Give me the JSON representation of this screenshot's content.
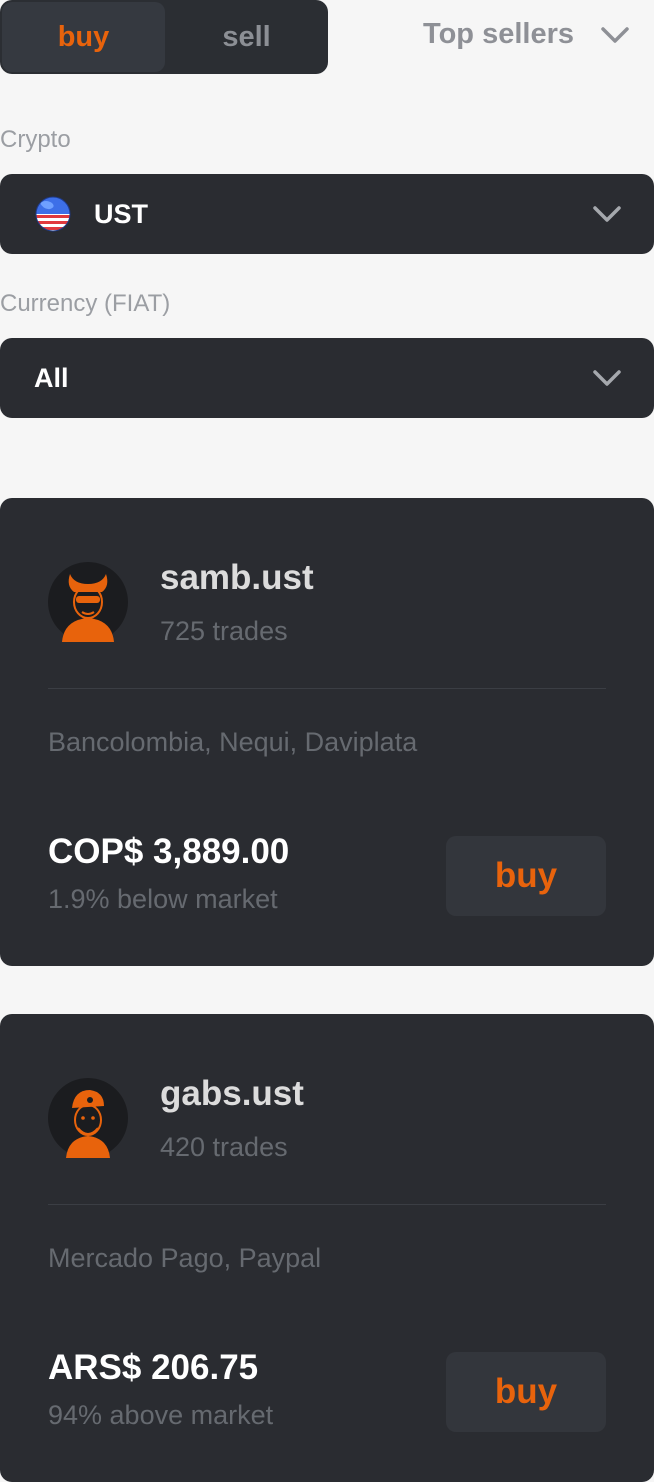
{
  "toggle": {
    "buy_label": "buy",
    "sell_label": "sell",
    "selected": "buy"
  },
  "sort": {
    "label": "Top sellers"
  },
  "crypto": {
    "label": "Crypto",
    "value": "UST",
    "icon": "ust-flag-globe-icon"
  },
  "currency": {
    "label": "Currency (FIAT)",
    "value": "All"
  },
  "offers": [
    {
      "username": "samb.ust",
      "trades": "725 trades",
      "methods": "Bancolombia, Nequi, Daviplata",
      "price": "COP$ 3,889.00",
      "market": "1.9% below market",
      "buy_label": "buy",
      "avatar": "bull-avatar-icon"
    },
    {
      "username": "gabs.ust",
      "trades": "420 trades",
      "methods": "Mercado Pago, Paypal",
      "price": "ARS$ 206.75",
      "market": "94% above market",
      "buy_label": "buy",
      "avatar": "cap-avatar-icon"
    }
  ],
  "colors": {
    "accent": "#e8630c",
    "card": "#2a2c31",
    "background": "#f6f6f6"
  }
}
